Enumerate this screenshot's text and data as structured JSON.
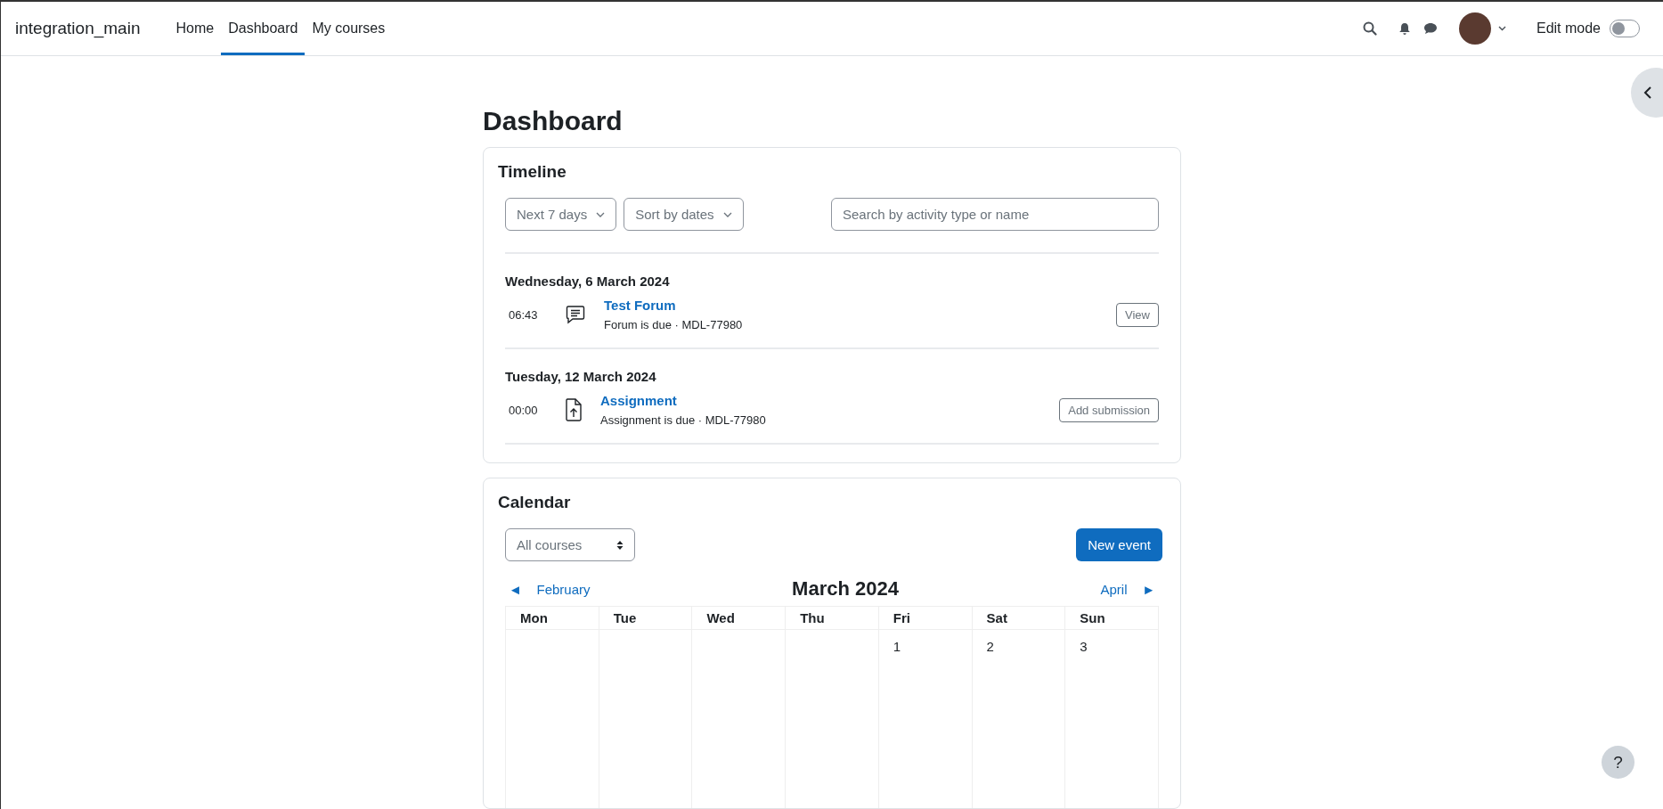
{
  "navbar": {
    "site_name": "integration_main",
    "items": [
      {
        "label": "Home",
        "selected": false
      },
      {
        "label": "Dashboard",
        "selected": true
      },
      {
        "label": "My courses",
        "selected": false
      }
    ],
    "edit_mode": {
      "label": "Edit mode",
      "on": false
    }
  },
  "page_title": "Dashboard",
  "timeline": {
    "title": "Timeline",
    "filter": "Next 7 days",
    "sort": "Sort by dates",
    "search": {
      "placeholder": "Search by activity type or name"
    },
    "groups": [
      {
        "date": "Wednesday, 6 March 2024",
        "events": [
          {
            "time": "06:43",
            "kind": "forum",
            "title": "Test Forum",
            "detail": "Forum is due · MDL-77980",
            "action": "View"
          }
        ]
      },
      {
        "date": "Tuesday, 12 March 2024",
        "events": [
          {
            "time": "00:00",
            "kind": "assignment",
            "title": "Assignment",
            "detail": "Assignment is due · MDL-77980",
            "action": "Add submission"
          }
        ]
      }
    ]
  },
  "calendar": {
    "title": "Calendar",
    "course_select": "All courses",
    "new_event": "New event",
    "prev": {
      "arrow": "◄",
      "label": "February"
    },
    "month": "March 2024",
    "next": {
      "label": "April",
      "arrow": "►"
    },
    "weekdays": [
      "Mon",
      "Tue",
      "Wed",
      "Thu",
      "Fri",
      "Sat",
      "Sun"
    ],
    "weeks": [
      [
        {
          "kind": "blank"
        },
        {
          "kind": "blank"
        },
        {
          "kind": "blank"
        },
        {
          "kind": "blank"
        },
        {
          "kind": "day",
          "day": "1"
        },
        {
          "kind": "day",
          "day": "2"
        },
        {
          "kind": "day",
          "day": "3"
        }
      ]
    ]
  },
  "help_button": "?"
}
